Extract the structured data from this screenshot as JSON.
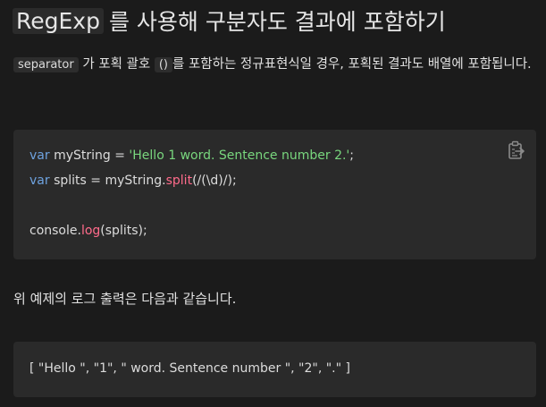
{
  "heading": {
    "code": "RegExp",
    "text": "를 사용해 구분자도 결과에 포함하기"
  },
  "paragraph1": {
    "code": "separator",
    "text_before_paren": "가 포획 괄호",
    "paren": "()",
    "text_after_paren": "를 포함하는 정규표현식일 경우, 포획된 결과도 배열에 포함됩니다."
  },
  "code_block1": {
    "line1": {
      "kw": "var",
      "plain": " myString = ",
      "str": "'Hello 1 word. Sentence number 2.'",
      "end": ";"
    },
    "line2": {
      "kw": "var",
      "plain": " splits = myString.",
      "fn": "split",
      "end": "(/(\\d)/);"
    },
    "line3": {
      "plain": "console.",
      "fn": "log",
      "end": "(splits);"
    },
    "copy_icon": "clipboard-copy-icon"
  },
  "paragraph2": {
    "text": "위 예제의 로그 출력은 다음과 같습니다."
  },
  "code_block2": {
    "line1": "[ \"Hello \", \"1\", \" word. Sentence number \", \"2\", \".\" ]"
  },
  "colors": {
    "background": "#1b1b1b",
    "code_bg": "#2a2a2a",
    "keyword": "#6ea2df",
    "string": "#79d77e",
    "function": "#ff6b8b"
  }
}
